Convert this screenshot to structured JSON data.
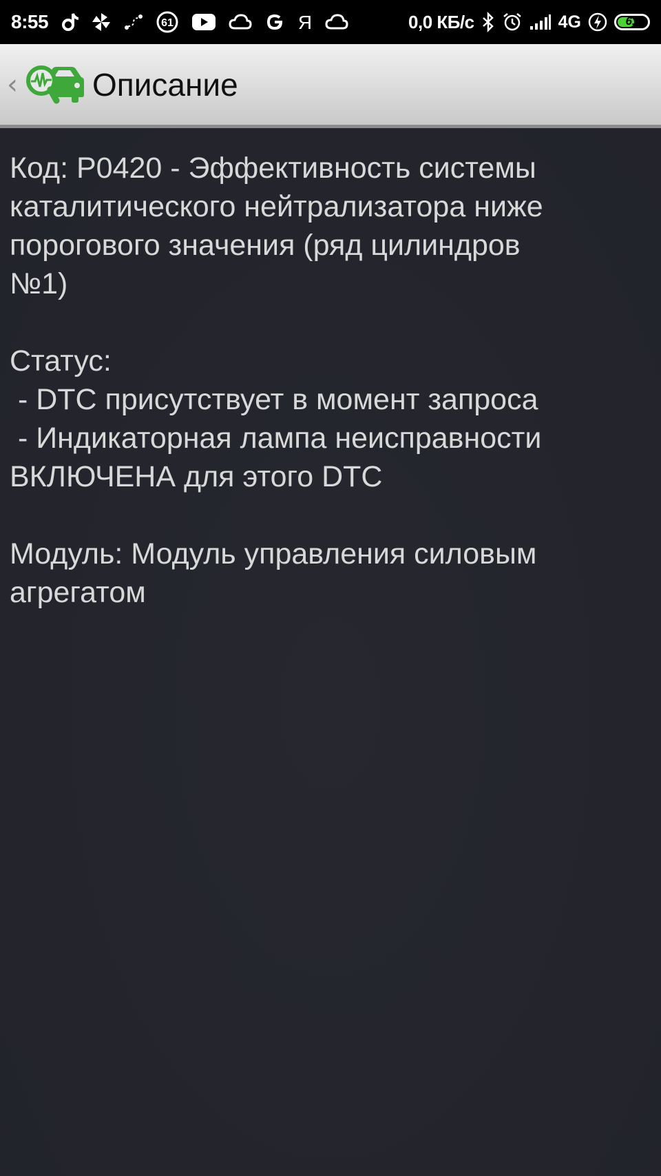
{
  "status_bar": {
    "time": "8:55",
    "notification_badge": "61",
    "network_speed": "0,0 КБ/с",
    "network_type": "4G",
    "battery_level": "61",
    "battery_fraction": 0.61,
    "icons": [
      "tiktok-icon",
      "pinwheel-icon",
      "route-icon",
      "badge-icon",
      "youtube-icon",
      "cloud-icon",
      "google-icon",
      "yandex-icon",
      "cloud-icon",
      "bluetooth-icon",
      "alarm-icon",
      "signal-icon",
      "charging-icon",
      "battery-icon"
    ]
  },
  "app_bar": {
    "title": "Описание",
    "accent_color": "#3ea83b"
  },
  "description": {
    "lines": [
      "Код: P0420 - Эффективность системы",
      "каталитического нейтрализатора ниже",
      "порогового значения (ряд цилиндров",
      "№1)",
      "",
      "Статус:",
      " - DTC присутствует в момент запроса",
      " - Индикаторная лампа неисправности",
      "ВКЛЮЧЕНА для этого DTC",
      "",
      "Модуль: Модуль управления силовым",
      "агрегатом"
    ]
  }
}
